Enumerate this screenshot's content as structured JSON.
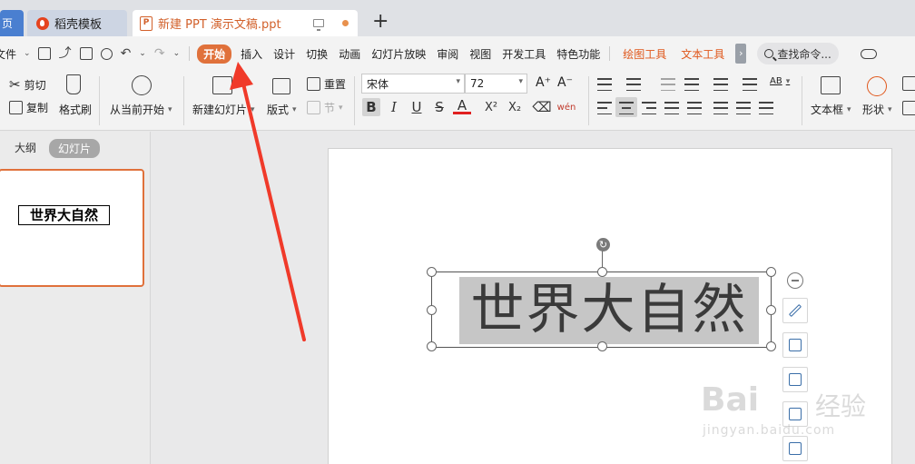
{
  "tabs": {
    "home": "页",
    "template": "稻壳模板",
    "document": "新建 PPT 演示文稿.ppt",
    "new_tab": "+"
  },
  "menu": {
    "file": "文件",
    "items": [
      "开始",
      "插入",
      "设计",
      "切换",
      "动画",
      "幻灯片放映",
      "审阅",
      "视图",
      "开发工具",
      "特色功能"
    ],
    "context_items": [
      "绘图工具",
      "文本工具"
    ],
    "more": "›",
    "search_placeholder": "查找命令..."
  },
  "ribbon": {
    "cut": "剪切",
    "copy": "复制",
    "format_painter": "格式刷",
    "play_from_current": "从当前开始",
    "new_slide": "新建幻灯片",
    "layout": "版式",
    "reset": "重置",
    "section": "节",
    "font_name": "宋体",
    "font_size": "72",
    "bold": "B",
    "italic": "I",
    "underline": "U",
    "strike": "S",
    "font_color": "A",
    "superscript": "X²",
    "subscript": "X₂",
    "phonetic": "wén",
    "grow_font": "A⁺",
    "shrink_font": "A⁻",
    "text_box": "文本框",
    "shape": "形状"
  },
  "left_pane": {
    "outline_tab": "大纲",
    "slides_tab": "幻灯片",
    "thumbnail_title": "世界大自然"
  },
  "slide": {
    "title_text": "世界大自然",
    "rotate_glyph": "↻"
  },
  "watermark": {
    "brand": "Bai",
    "brand_cn": "经验",
    "url": "jingyan.baidu.com"
  },
  "colors": {
    "accent": "#e0713b",
    "arrow": "#f03a2a",
    "context_tab": "#e0571b"
  }
}
